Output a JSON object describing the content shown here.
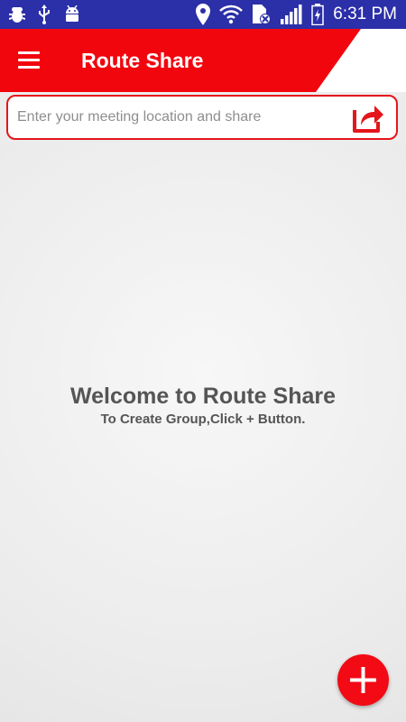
{
  "status_bar": {
    "time": "6:31 PM",
    "left_icons": [
      "bug-icon",
      "usb-icon",
      "android-icon"
    ],
    "right_icons": [
      "location-pin-icon",
      "wifi-icon",
      "sim-disabled-icon",
      "signal-icon",
      "battery-charging-icon"
    ]
  },
  "app_bar": {
    "title": "Route Share",
    "menu_icon": "hamburger-menu-icon",
    "color": "#f2060e"
  },
  "search": {
    "placeholder": "Enter your meeting location and share",
    "value": "",
    "share_icon": "share-arrow-icon"
  },
  "welcome": {
    "title": "Welcome to Route Share",
    "subtitle": "To Create Group,Click + Button."
  },
  "fab": {
    "icon": "plus-icon",
    "color": "#f20a14"
  }
}
